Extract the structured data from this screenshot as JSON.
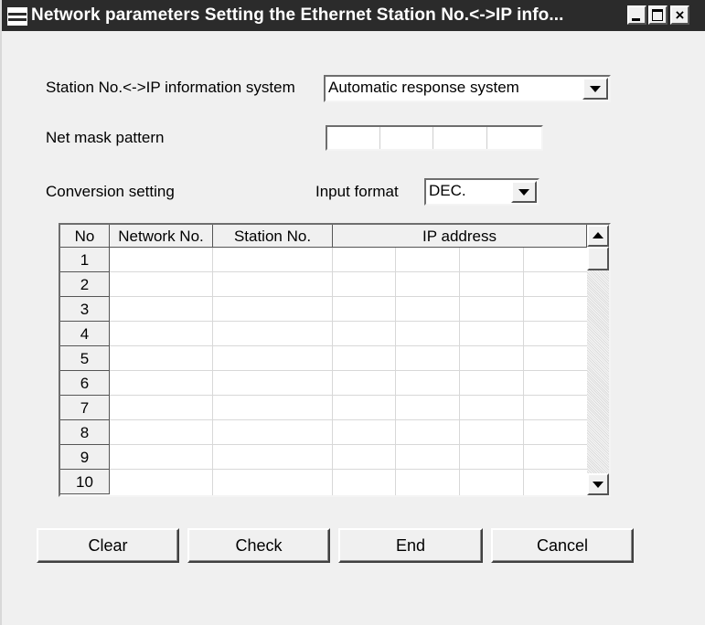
{
  "window": {
    "title": "Network parameters  Setting the Ethernet Station No.<->IP info..."
  },
  "form": {
    "system_label": "Station No.<->IP information system",
    "system_value": "Automatic response system",
    "netmask_label": "Net mask pattern",
    "netmask_octets": [
      "",
      "",
      "",
      ""
    ],
    "conversion_label": "Conversion setting",
    "input_format_label": "Input format",
    "input_format_value": "DEC."
  },
  "table": {
    "headers": [
      "No",
      "Network No.",
      "Station No.",
      "IP address"
    ],
    "rows": [
      {
        "no": "1",
        "network_no": "",
        "station_no": "",
        "ip": [
          "",
          "",
          "",
          ""
        ]
      },
      {
        "no": "2",
        "network_no": "",
        "station_no": "",
        "ip": [
          "",
          "",
          "",
          ""
        ]
      },
      {
        "no": "3",
        "network_no": "",
        "station_no": "",
        "ip": [
          "",
          "",
          "",
          ""
        ]
      },
      {
        "no": "4",
        "network_no": "",
        "station_no": "",
        "ip": [
          "",
          "",
          "",
          ""
        ]
      },
      {
        "no": "5",
        "network_no": "",
        "station_no": "",
        "ip": [
          "",
          "",
          "",
          ""
        ]
      },
      {
        "no": "6",
        "network_no": "",
        "station_no": "",
        "ip": [
          "",
          "",
          "",
          ""
        ]
      },
      {
        "no": "7",
        "network_no": "",
        "station_no": "",
        "ip": [
          "",
          "",
          "",
          ""
        ]
      },
      {
        "no": "8",
        "network_no": "",
        "station_no": "",
        "ip": [
          "",
          "",
          "",
          ""
        ]
      },
      {
        "no": "9",
        "network_no": "",
        "station_no": "",
        "ip": [
          "",
          "",
          "",
          ""
        ]
      },
      {
        "no": "10",
        "network_no": "",
        "station_no": "",
        "ip": [
          "",
          "",
          "",
          ""
        ]
      }
    ]
  },
  "buttons": {
    "clear": "Clear",
    "check": "Check",
    "end": "End",
    "cancel": "Cancel"
  },
  "icons": {
    "system_menu": "system-menu-icon",
    "minimize": "minimize-icon",
    "maximize": "maximize-icon",
    "close": "close-icon",
    "dropdown": "chevron-down-icon",
    "scroll_up": "scroll-up-icon",
    "scroll_down": "scroll-down-icon"
  },
  "colors": {
    "titlebar": "#2b2b2b",
    "face": "#f0f0f0"
  }
}
